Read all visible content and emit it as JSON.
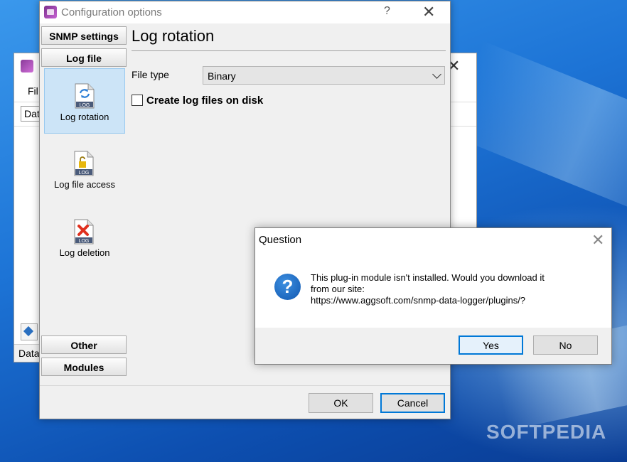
{
  "background_window": {
    "menu_file": "Fil",
    "toolbar_field": "Dat",
    "status_text": "Data"
  },
  "config_dialog": {
    "title": "Configuration options",
    "help_glyph": "?",
    "close_glyph": "✕",
    "side_buttons": [
      "SNMP settings",
      "Log file",
      "Other",
      "Modules"
    ],
    "nav_items": [
      {
        "label": "Log rotation",
        "icon": "log-rotation-icon",
        "selected": true
      },
      {
        "label": "Log file access",
        "icon": "log-file-access-icon",
        "selected": false
      },
      {
        "label": "Log deletion",
        "icon": "log-deletion-icon",
        "selected": false
      }
    ],
    "panel_title": "Log rotation",
    "file_type_label": "File type",
    "file_type_value": "Binary",
    "checkbox_label": "Create log files on disk",
    "checkbox_checked": false,
    "ok_label": "OK",
    "cancel_label": "Cancel"
  },
  "question_dialog": {
    "title": "Question",
    "close_glyph": "✕",
    "icon": "question-icon",
    "message_line1": "This plug-in module isn't installed. Would you download it",
    "message_line2": "from our site:",
    "message_line3": "https://www.aggsoft.com/snmp-data-logger/plugins/?",
    "yes_label": "Yes",
    "no_label": "No"
  },
  "watermark": "SOFTPEDIA",
  "colors": {
    "accent": "#0078d7",
    "selection": "#cce4f7",
    "desktop": "#1d74d6"
  }
}
